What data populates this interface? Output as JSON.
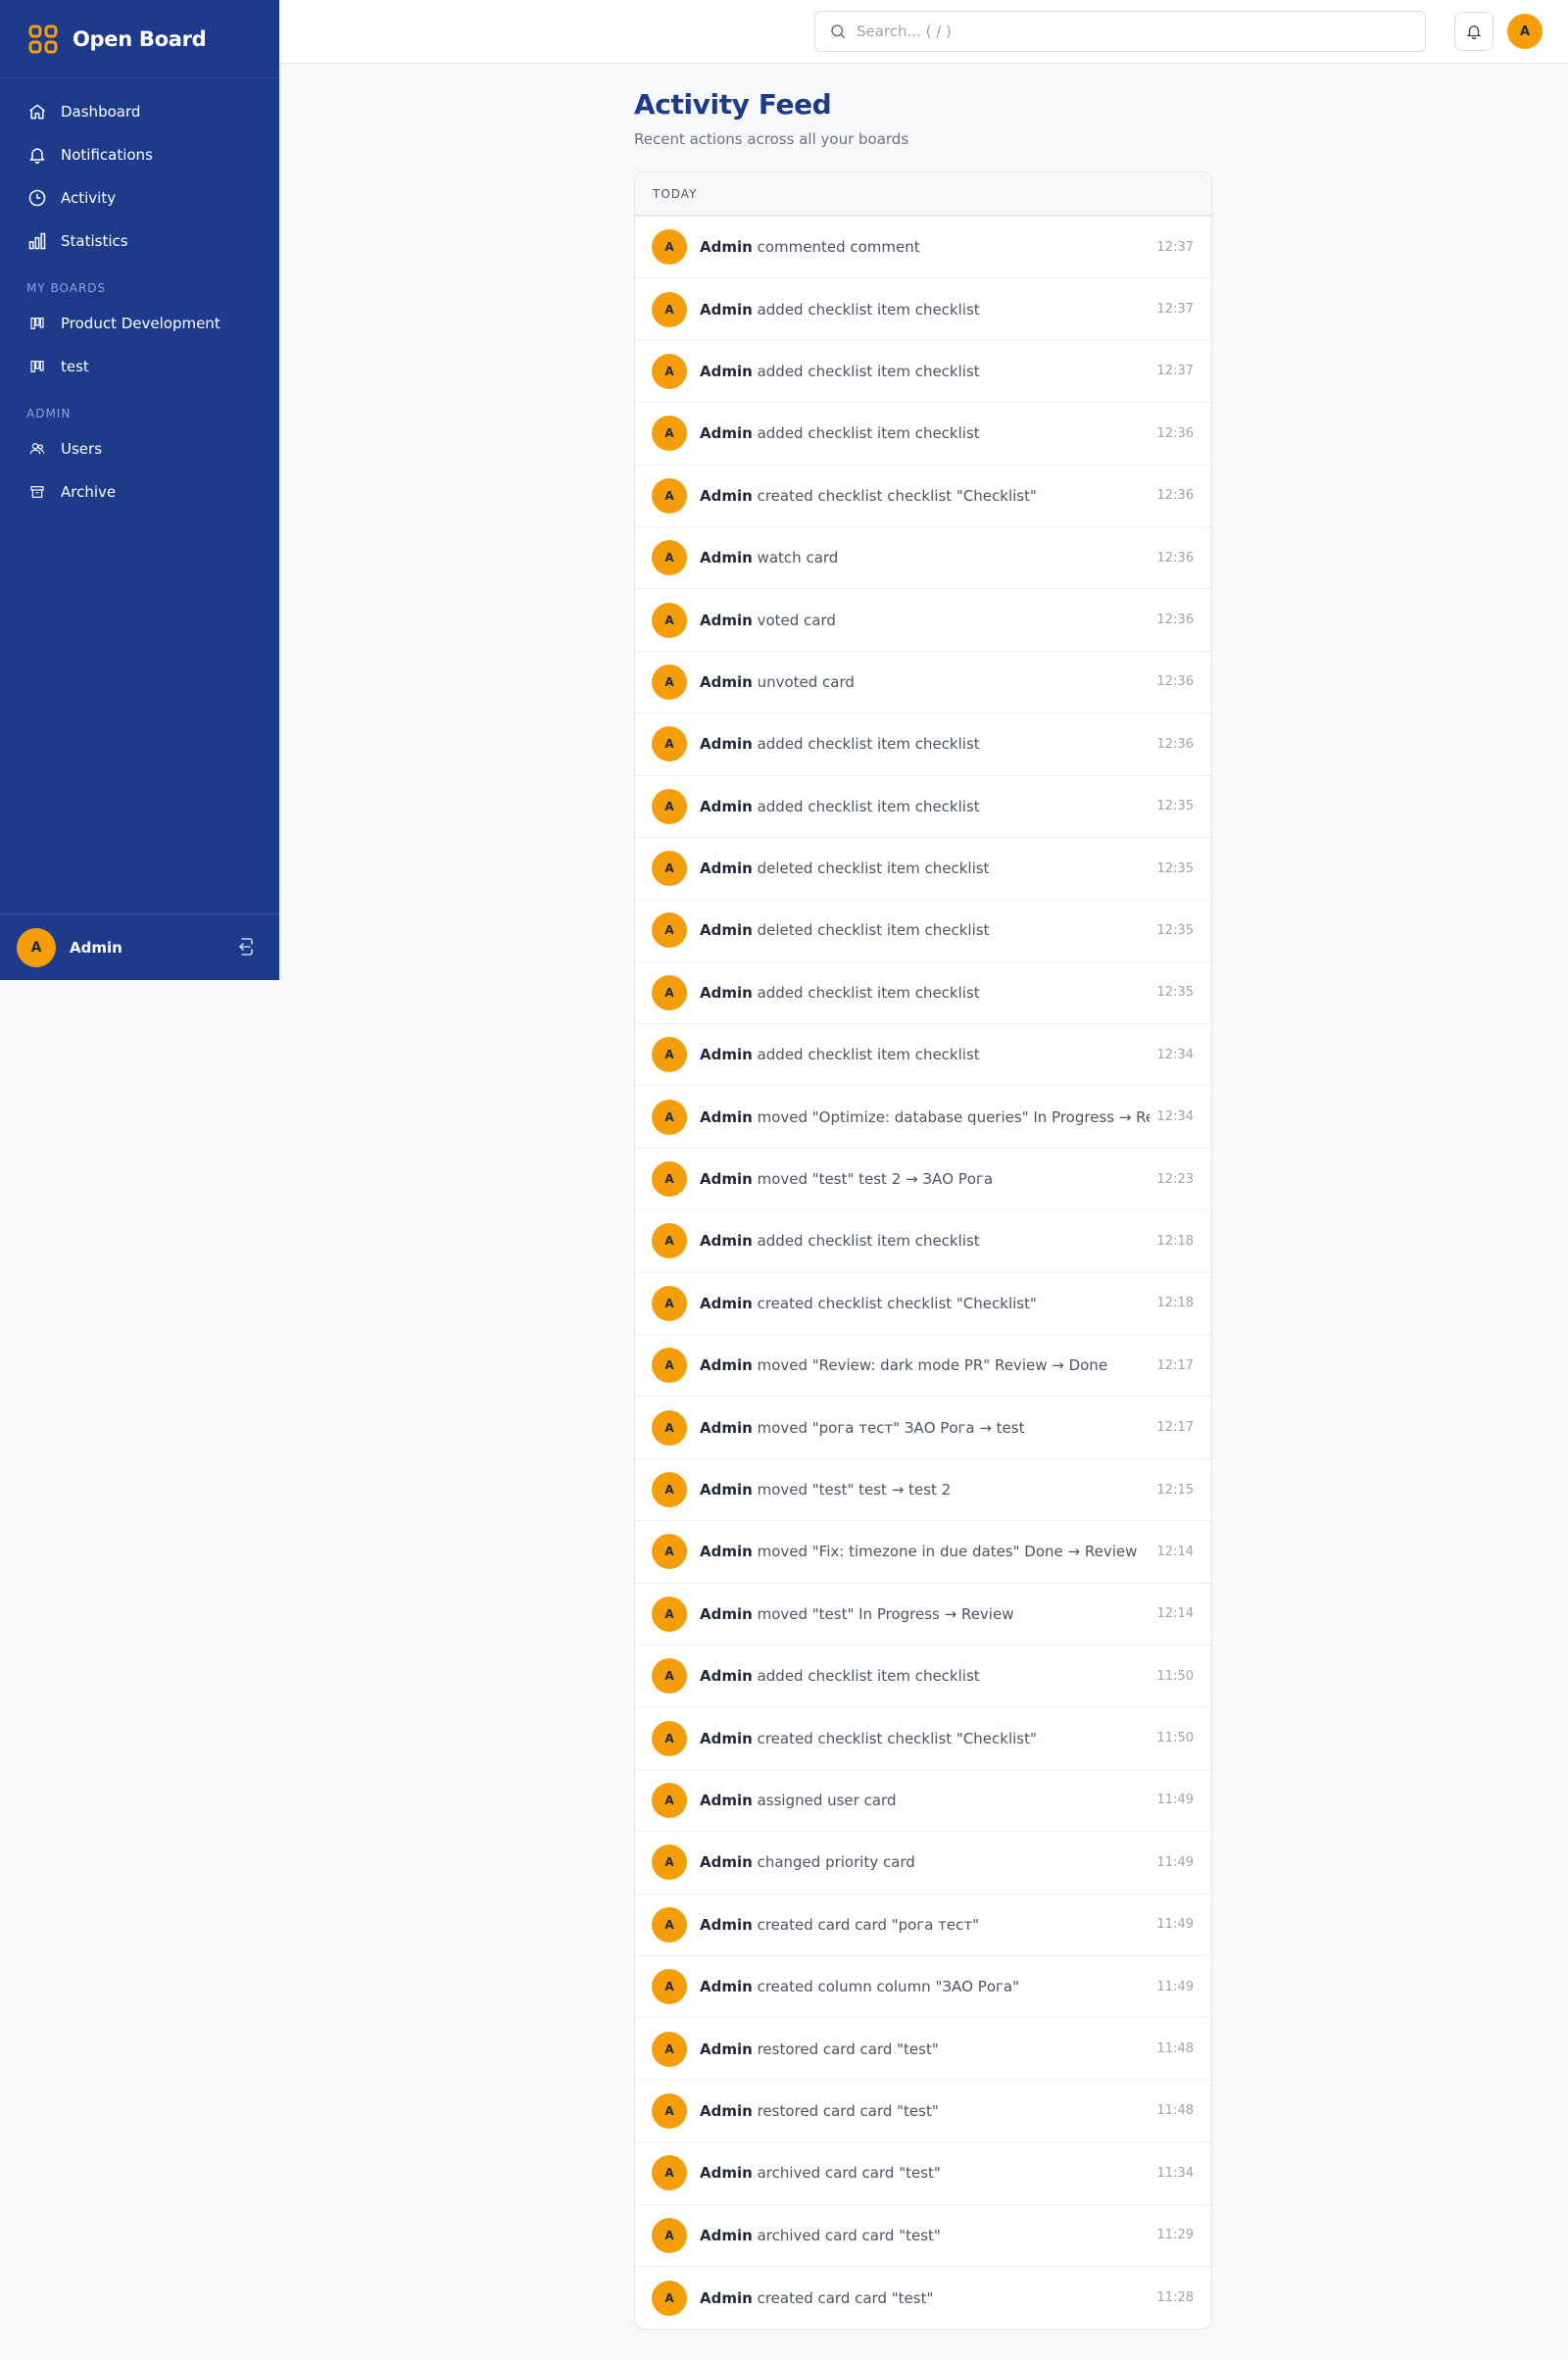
{
  "app": {
    "name": "Open Board"
  },
  "sidebar": {
    "nav": [
      {
        "label": "Dashboard",
        "icon": "home-icon"
      },
      {
        "label": "Notifications",
        "icon": "bell-icon"
      },
      {
        "label": "Activity",
        "icon": "clock-icon"
      },
      {
        "label": "Statistics",
        "icon": "bar-chart-icon"
      }
    ],
    "boards_label": "MY BOARDS",
    "boards": [
      {
        "label": "Product Development",
        "icon": "board-icon"
      },
      {
        "label": "test",
        "icon": "board-icon"
      }
    ],
    "admin_label": "ADMIN",
    "admin": [
      {
        "label": "Users",
        "icon": "users-icon"
      },
      {
        "label": "Archive",
        "icon": "archive-icon"
      }
    ],
    "user": {
      "initial": "A",
      "name": "Admin"
    }
  },
  "topbar": {
    "search_placeholder": "Search... ( / )",
    "avatar_initial": "A"
  },
  "page": {
    "title": "Activity Feed",
    "subtitle": "Recent actions across all your boards"
  },
  "feed": {
    "group_label": "TODAY",
    "items": [
      {
        "initial": "A",
        "user": "Admin",
        "action": "commented comment",
        "time": "12:37"
      },
      {
        "initial": "A",
        "user": "Admin",
        "action": "added checklist item checklist",
        "time": "12:37"
      },
      {
        "initial": "A",
        "user": "Admin",
        "action": "added checklist item checklist",
        "time": "12:37"
      },
      {
        "initial": "A",
        "user": "Admin",
        "action": "added checklist item checklist",
        "time": "12:36"
      },
      {
        "initial": "A",
        "user": "Admin",
        "action": "created checklist checklist \"Checklist\"",
        "time": "12:36"
      },
      {
        "initial": "A",
        "user": "Admin",
        "action": "watch card",
        "time": "12:36"
      },
      {
        "initial": "A",
        "user": "Admin",
        "action": "voted card",
        "time": "12:36"
      },
      {
        "initial": "A",
        "user": "Admin",
        "action": "unvoted card",
        "time": "12:36"
      },
      {
        "initial": "A",
        "user": "Admin",
        "action": "added checklist item checklist",
        "time": "12:36"
      },
      {
        "initial": "A",
        "user": "Admin",
        "action": "added checklist item checklist",
        "time": "12:35"
      },
      {
        "initial": "A",
        "user": "Admin",
        "action": "deleted checklist item checklist",
        "time": "12:35"
      },
      {
        "initial": "A",
        "user": "Admin",
        "action": "deleted checklist item checklist",
        "time": "12:35"
      },
      {
        "initial": "A",
        "user": "Admin",
        "action": "added checklist item checklist",
        "time": "12:35"
      },
      {
        "initial": "A",
        "user": "Admin",
        "action": "added checklist item checklist",
        "time": "12:34"
      },
      {
        "initial": "A",
        "user": "Admin",
        "action": "moved \"Optimize: database queries\" In Progress → Review",
        "time": "12:34"
      },
      {
        "initial": "A",
        "user": "Admin",
        "action": "moved \"test\" test 2 → ЗАО Рога",
        "time": "12:23"
      },
      {
        "initial": "A",
        "user": "Admin",
        "action": "added checklist item checklist",
        "time": "12:18"
      },
      {
        "initial": "A",
        "user": "Admin",
        "action": "created checklist checklist \"Checklist\"",
        "time": "12:18"
      },
      {
        "initial": "A",
        "user": "Admin",
        "action": "moved \"Review: dark mode PR\" Review → Done",
        "time": "12:17"
      },
      {
        "initial": "A",
        "user": "Admin",
        "action": "moved \"рога тест\" ЗАО Рога → test",
        "time": "12:17"
      },
      {
        "initial": "A",
        "user": "Admin",
        "action": "moved \"test\" test → test 2",
        "time": "12:15"
      },
      {
        "initial": "A",
        "user": "Admin",
        "action": "moved \"Fix: timezone in due dates\" Done → Review",
        "time": "12:14"
      },
      {
        "initial": "A",
        "user": "Admin",
        "action": "moved \"test\" In Progress → Review",
        "time": "12:14"
      },
      {
        "initial": "A",
        "user": "Admin",
        "action": "added checklist item checklist",
        "time": "11:50"
      },
      {
        "initial": "A",
        "user": "Admin",
        "action": "created checklist checklist \"Checklist\"",
        "time": "11:50"
      },
      {
        "initial": "A",
        "user": "Admin",
        "action": "assigned user card",
        "time": "11:49"
      },
      {
        "initial": "A",
        "user": "Admin",
        "action": "changed priority card",
        "time": "11:49"
      },
      {
        "initial": "A",
        "user": "Admin",
        "action": "created card card \"рога тест\"",
        "time": "11:49"
      },
      {
        "initial": "A",
        "user": "Admin",
        "action": "created column column \"ЗАО Рога\"",
        "time": "11:49"
      },
      {
        "initial": "A",
        "user": "Admin",
        "action": "restored card card \"test\"",
        "time": "11:48"
      },
      {
        "initial": "A",
        "user": "Admin",
        "action": "restored card card \"test\"",
        "time": "11:48"
      },
      {
        "initial": "A",
        "user": "Admin",
        "action": "archived card card \"test\"",
        "time": "11:34"
      },
      {
        "initial": "A",
        "user": "Admin",
        "action": "archived card card \"test\"",
        "time": "11:29"
      },
      {
        "initial": "A",
        "user": "Admin",
        "action": "created card card \"test\"",
        "time": "11:28"
      }
    ]
  },
  "colors": {
    "sidebar_bg": "#1e3a8a",
    "accent": "#f59e0b",
    "title": "#1e3a8a"
  }
}
